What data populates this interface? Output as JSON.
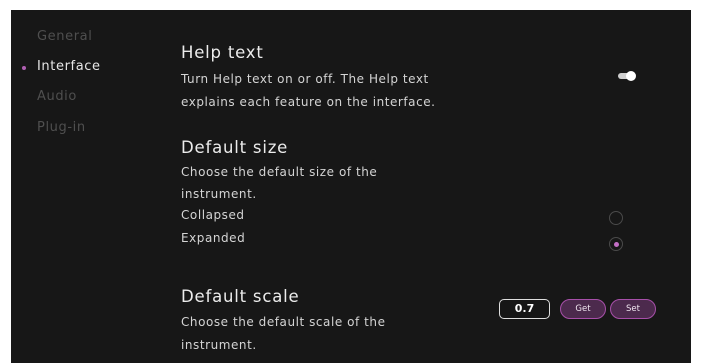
{
  "sidebar": {
    "items": [
      {
        "label": "General",
        "active": false
      },
      {
        "label": "Interface",
        "active": true
      },
      {
        "label": "Audio",
        "active": false
      },
      {
        "label": "Plug-in",
        "active": false
      }
    ]
  },
  "help_text": {
    "title": "Help text",
    "description_line1": "Turn Help text on or off. The Help text",
    "description_line2": "explains each feature on the interface.",
    "enabled": true
  },
  "default_size": {
    "title": "Default size",
    "description_line1": "Choose the default size of the",
    "description_line2": "instrument.",
    "options": [
      {
        "label": "Collapsed",
        "selected": false
      },
      {
        "label": "Expanded",
        "selected": true
      }
    ]
  },
  "default_scale": {
    "title": "Default scale",
    "description_line1": "Choose the default scale of the",
    "description_line2": "instrument.",
    "value": "0.7",
    "get_label": "Get",
    "set_label": "Set"
  },
  "colors": {
    "background": "#171717",
    "accent": "#b05fb2",
    "button_fill": "#4c2a4d",
    "text": "#d4d4d4",
    "muted_text": "#4f4f4f"
  }
}
